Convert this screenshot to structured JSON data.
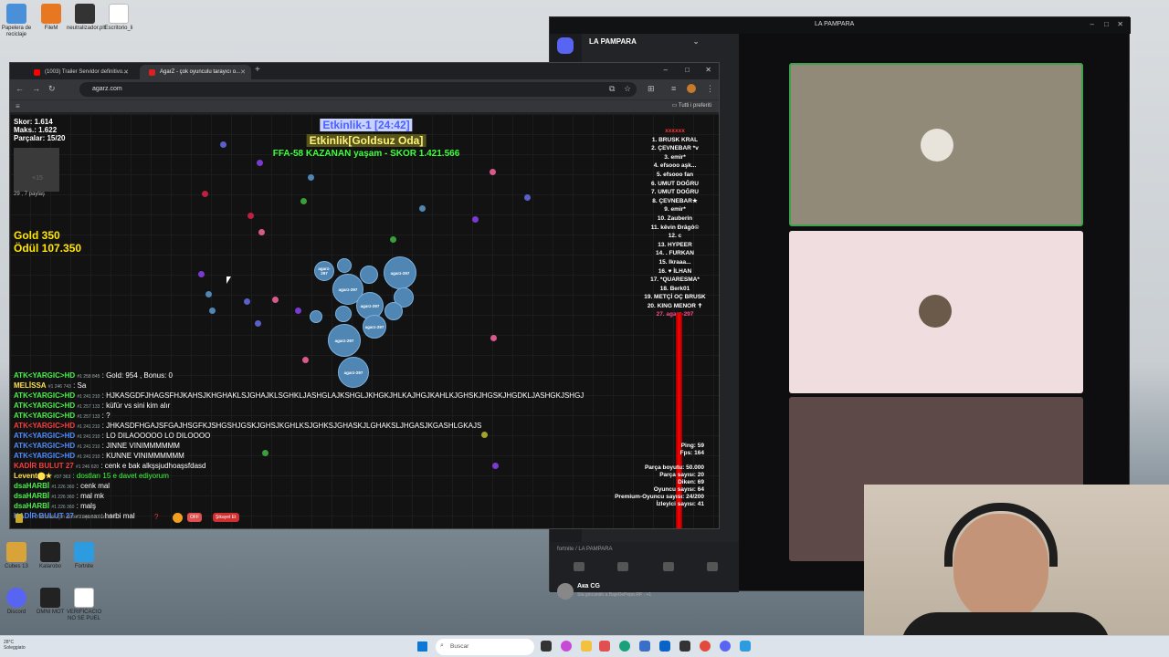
{
  "desktop": {
    "icons": [
      {
        "label": "Papelera de reciclaje",
        "color": "#4a90d9"
      },
      {
        "label": "FileM",
        "color": "#e87722"
      },
      {
        "label": "neutralizador.plt",
        "color": "#333"
      },
      {
        "label": "Escritorio_li",
        "color": "#fff"
      },
      {
        "label": "Cubes 13",
        "color": "#d8a43a"
      },
      {
        "label": "Kalarobo",
        "color": "#222"
      },
      {
        "label": "Fortnite",
        "color": "#2d9be0"
      },
      {
        "label": "Discord",
        "color": "#5865f2"
      },
      {
        "label": "OMNI MOT",
        "color": "#222"
      },
      {
        "label": "VERIFICACIO NO SE PUEL",
        "color": "#fff"
      }
    ]
  },
  "browser": {
    "tabs": [
      {
        "label": "(1003) Trailer Servidor definitivo...",
        "favicon_color": "#ff0000"
      },
      {
        "label": "AgarZ - çok oyunculu tarayıcı o...",
        "favicon_color": "#e02020"
      }
    ],
    "newtab": "+",
    "url": "agarz.com",
    "bookmarks_folder": "Tutti i preferiti",
    "window_min": "–",
    "window_max": "□",
    "window_close": "✕"
  },
  "game": {
    "score": "Skor: 1.614",
    "max": "Maks.: 1.622",
    "parts": "Parçalar: 15/20",
    "minimap_note": "29 , 7 paylaş",
    "minimap_label": "+15",
    "gold": "Gold 350",
    "reward": "Ödül 107.350",
    "banner1": "Etkinlik-1 [24:42]",
    "banner2": "Etkinlik[Goldsuz Oda]",
    "banner3": "FFA-58 KAZANAN yaşam - SKOR 1.421.566",
    "leaderboard_title": "xxxxxx",
    "leaderboard": [
      "1. BRUSK KRAL",
      "2. ÇEVNEBAR *v",
      "3. emir*",
      "4. efsooo aşk...",
      "5. efsooo fan",
      "6. UMUT DOĞRU",
      "7. UMUT DOĞRU",
      "8. ÇEVNEBAR★",
      "9. emir*",
      "10. Zauberin",
      "11. kêvin Ðrâgô©",
      "12. c",
      "13. HYPEER",
      "14. . FURKAN",
      "15. Ikraaa...",
      "16. ♥ İLHAN",
      "17. *QUARESMA*",
      "18. Berk01",
      "19. METÇİ OÇ BRUSK",
      "20. KING MENOR ✝"
    ],
    "me": "27. agarz-297",
    "cell_name": "agarz-297",
    "chat": [
      {
        "name": "ATK<YARGIC>HD",
        "rank": "#1 258 845",
        "msg": ": Gold: 954 , Bonus: 0",
        "color": "#4af04a"
      },
      {
        "name": "MELİSSA",
        "rank": "#1 246 743",
        "msg": ": Sa",
        "color": "#ffe14a"
      },
      {
        "name": "ATK<YARGIC>HD",
        "rank": "#1 241 210",
        "msg": ": HJKASGDFJHAGSFHJKAHSJKHGHAKLSJGHAJKLSGHKLJASHGLAJKSHGLJKHGKJHLKAJHGJKAHLKJGHSKJHGSKJHGDKLJASHGKJSHGJ",
        "color": "#4af04a"
      },
      {
        "name": "ATK<YARGIC>HD",
        "rank": "#1 257 133",
        "msg": ": küfür vs sini kim alır",
        "color": "#4af04a"
      },
      {
        "name": "ATK<YARGIC>HD",
        "rank": "#1 257 133",
        "msg": ": ?",
        "color": "#4af04a"
      },
      {
        "name": "ATK<YARGIC>HD",
        "rank": "#1 241 210",
        "msg": ": JHKASDFHGAJSFGAJHSGFKJSHGSHJGSKJGHSJKGHLKSJGHKSJGHASKJLGHAKSLJHGASJKGASHLGKAJS",
        "color": "#ff3b3b"
      },
      {
        "name": "ATK<YARGIC>HD",
        "rank": "#1 241 210",
        "msg": ": LO DILAOOOOO LO DILOOOO",
        "color": "#4f8cff"
      },
      {
        "name": "ATK<YARGIC>HD",
        "rank": "#1 241 210",
        "msg": ": JINNE VINIMMMMMM",
        "color": "#4f8cff"
      },
      {
        "name": "ATK<YARGIC>HD",
        "rank": "#1 241 210",
        "msg": ": KUNNE VINIMMMMMM",
        "color": "#4f8cff"
      },
      {
        "name": "KADİR BULUT 27",
        "rank": "#1 246 620",
        "msg": ": cenk e bak alkşsjudhoaşsfdasd",
        "color": "#ff3b3b"
      },
      {
        "name": "Levent⬤★",
        "rank": "#37 363",
        "msg": ": dostları 15 e davet ediyorum",
        "color": "#ffe14a",
        "msgcolor": "#3cff3c"
      },
      {
        "name": "dsaHARBİ",
        "rank": "#1 226 360",
        "msg": ": cenk mal",
        "color": "#4af04a"
      },
      {
        "name": "dsaHARBİ",
        "rank": "#1 226 360",
        "msg": ": mal mk",
        "color": "#4af04a"
      },
      {
        "name": "dsaHARBİ",
        "rank": "#1 226 360",
        "msg": ": malş",
        "color": "#4af04a"
      },
      {
        "name": "KADİR BULUT 27",
        "rank": "#1 246 620",
        "msg": ": harbi mal",
        "color": "#4f8cff"
      }
    ],
    "stats": [
      "Ping: 59",
      "Fps: 164",
      "",
      "Parça boyutu: 50.000",
      "Parça sayısı: 20",
      "Diken: 69",
      "Oyuncu sayısı: 64",
      "Premium-Oyuncu sayısı: 24/200",
      "İzleyici sayısı: 41"
    ],
    "chat_placeholder": "Yazmak için enter tuşuna basınız",
    "toggle_off": "OFF",
    "report_button": "Şikayet Et"
  },
  "discord": {
    "window_title": "LA PAMPARA",
    "server": "LA PAMPARA",
    "voice_channel": "fortnite / LA PAMPARA",
    "user": "Ака CG",
    "user_status": "Sta giocando a BajeDePepa RP · +1"
  },
  "taskbar": {
    "search": "Buscar",
    "weather_temp": "28°C",
    "weather_desc": "Soleggiato"
  }
}
